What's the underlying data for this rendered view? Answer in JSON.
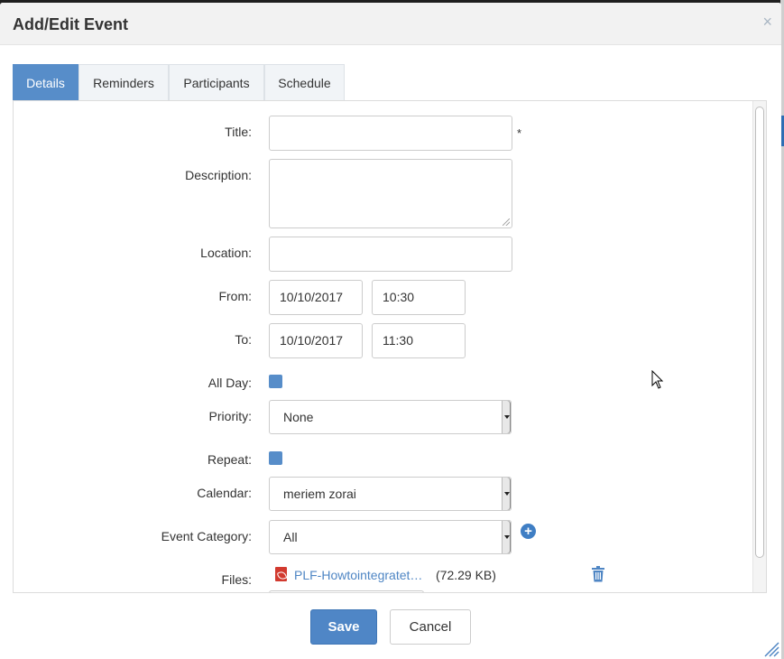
{
  "dialog": {
    "title": "Add/Edit Event",
    "close_icon": "close-icon",
    "close_glyph": "×"
  },
  "tabs": [
    {
      "label": "Details",
      "active": true
    },
    {
      "label": "Reminders",
      "active": false
    },
    {
      "label": "Participants",
      "active": false
    },
    {
      "label": "Schedule",
      "active": false
    }
  ],
  "form": {
    "title_label": "Title:",
    "title_value": "",
    "required_mark": "*",
    "description_label": "Description:",
    "description_value": "",
    "location_label": "Location:",
    "location_value": "",
    "from_label": "From:",
    "from_date": "10/10/2017",
    "from_time": "10:30",
    "to_label": "To:",
    "to_date": "10/10/2017",
    "to_time": "11:30",
    "allday_label": "All Day:",
    "priority_label": "Priority:",
    "priority_value": "None",
    "repeat_label": "Repeat:",
    "calendar_label": "Calendar:",
    "calendar_value": "meriem zorai",
    "category_label": "Event Category:",
    "category_value": "All",
    "add_category_icon": "plus-circle-icon",
    "files_label": "Files:",
    "file_name": "PLF-Howtointegratet…",
    "file_size": "(72.29 KB)",
    "file_icon": "pdf-icon",
    "delete_icon": "trash-icon"
  },
  "footer": {
    "save_label": "Save",
    "cancel_label": "Cancel"
  },
  "colors": {
    "accent": "#578dc9",
    "button_primary": "#4f86c6",
    "link": "#4f86c4"
  }
}
